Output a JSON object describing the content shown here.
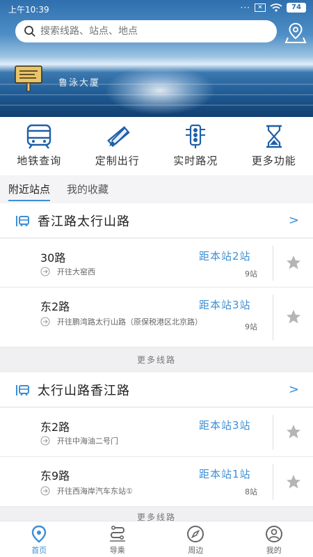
{
  "status": {
    "time": "上午10:39",
    "battery": "74",
    "dots": "···",
    "sim": "✕"
  },
  "search": {
    "placeholder": "搜索线路、站点、地点"
  },
  "hero": {
    "caption": "鲁泳大厦"
  },
  "quick_actions": [
    {
      "label": "地铁查询",
      "icon": "subway-icon"
    },
    {
      "label": "定制出行",
      "icon": "pencil-ruler-icon"
    },
    {
      "label": "实时路况",
      "icon": "traffic-light-icon"
    },
    {
      "label": "更多功能",
      "icon": "hourglass-icon"
    }
  ],
  "tabs": [
    {
      "label": "附近站点",
      "active": true
    },
    {
      "label": "我的收藏",
      "active": false
    }
  ],
  "stations": [
    {
      "name": "香江路太行山路",
      "arrow": ">",
      "routes": [
        {
          "name": "30路",
          "distance": "距本站2站",
          "direction": "开往大窑西",
          "stops": "9站"
        },
        {
          "name": "东2路",
          "distance": "距本站3站",
          "direction": "开往鹏湾路太行山路（原保税港区北京路）",
          "stops": "9站"
        }
      ],
      "more": "更多线路"
    },
    {
      "name": "太行山路香江路",
      "arrow": ">",
      "routes": [
        {
          "name": "东2路",
          "distance": "距本站3站",
          "direction": "开往中海油二号门",
          "stops": ""
        },
        {
          "name": "东9路",
          "distance": "距本站1站",
          "direction": "开往西海岸汽车东站①",
          "stops": "8站"
        }
      ],
      "more": "更多线路"
    }
  ],
  "bottom_nav": [
    {
      "label": "首页",
      "active": true
    },
    {
      "label": "导乘",
      "active": false
    },
    {
      "label": "周边",
      "active": false
    },
    {
      "label": "我的",
      "active": false
    }
  ],
  "colors": {
    "accent": "#3c8fd6",
    "text": "#222222",
    "secondary": "#666666"
  }
}
